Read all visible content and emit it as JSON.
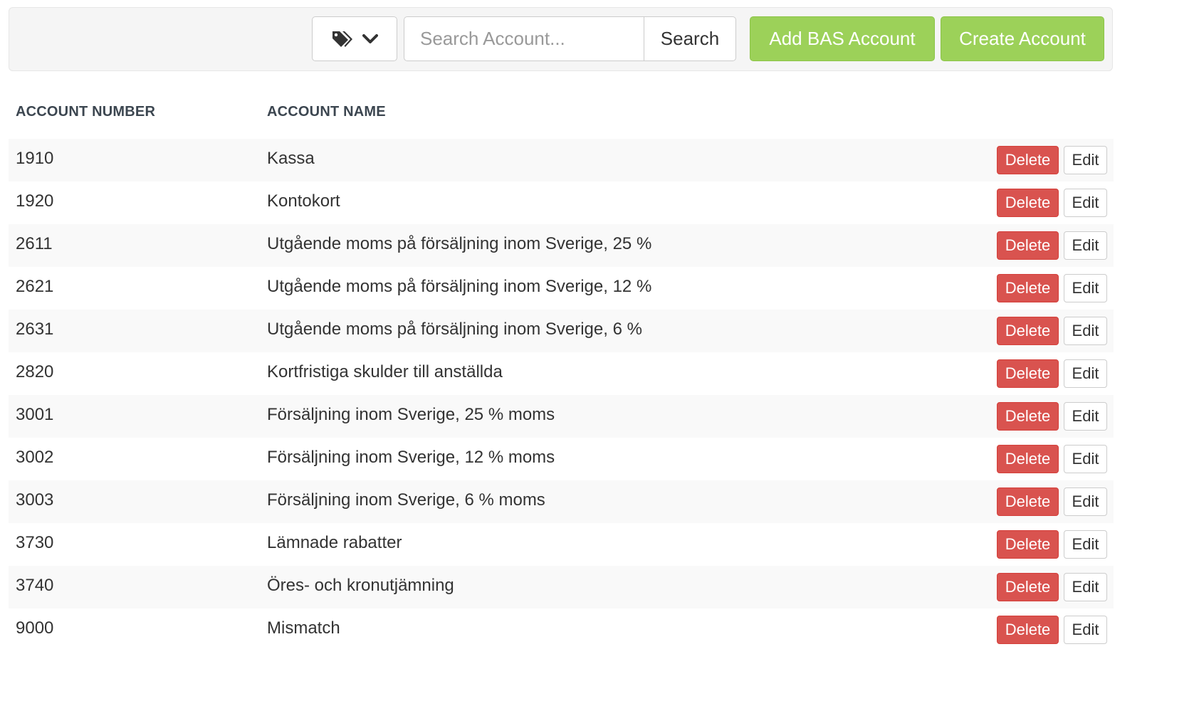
{
  "toolbar": {
    "tag_icon": "tags-icon",
    "dropdown_icon": "chevron-down-icon",
    "search": {
      "placeholder": "Search Account...",
      "value": "",
      "button_label": "Search"
    },
    "add_bas_label": "Add BAS Account",
    "create_label": "Create Account",
    "button_color": "#9cd159"
  },
  "table": {
    "headers": {
      "number": "ACCOUNT NUMBER",
      "name": "ACCOUNT NAME"
    },
    "delete_label": "Delete",
    "edit_label": "Edit",
    "delete_color": "#d9534f",
    "rows": [
      {
        "number": "1910",
        "name": "Kassa"
      },
      {
        "number": "1920",
        "name": "Kontokort"
      },
      {
        "number": "2611",
        "name": "Utgående moms på försäljning inom Sverige, 25 %"
      },
      {
        "number": "2621",
        "name": "Utgående moms på försäljning inom Sverige, 12 %"
      },
      {
        "number": "2631",
        "name": "Utgående moms på försäljning inom Sverige, 6 %"
      },
      {
        "number": "2820",
        "name": "Kortfristiga skulder till anställda"
      },
      {
        "number": "3001",
        "name": "Försäljning inom Sverige, 25 % moms"
      },
      {
        "number": "3002",
        "name": "Försäljning inom Sverige, 12 % moms"
      },
      {
        "number": "3003",
        "name": "Försäljning inom Sverige, 6 % moms"
      },
      {
        "number": "3730",
        "name": "Lämnade rabatter"
      },
      {
        "number": "3740",
        "name": "Öres- och kronutjämning"
      },
      {
        "number": "9000",
        "name": "Mismatch"
      }
    ]
  }
}
